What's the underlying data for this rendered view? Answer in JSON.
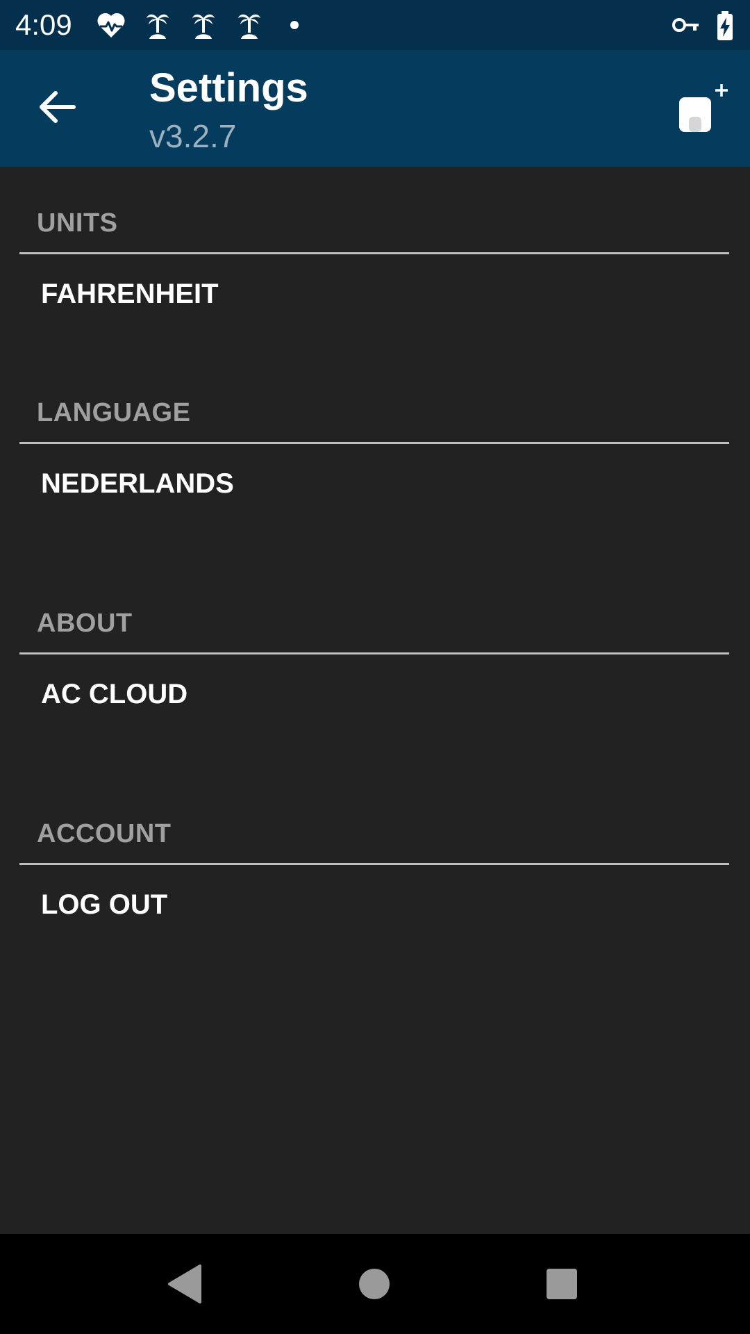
{
  "status_bar": {
    "time": "4:09",
    "icons": [
      "heart-pulse-icon",
      "palm-tree-icon",
      "palm-tree-icon",
      "palm-tree-icon",
      "dot-icon",
      "vpn-key-icon",
      "battery-charging-icon"
    ]
  },
  "app_bar": {
    "title": "Settings",
    "subtitle": "v3.2.7",
    "back_icon": "arrow-left-icon",
    "action_icon": "add-device-icon"
  },
  "sections": [
    {
      "header": "UNITS",
      "item": "FAHRENHEIT"
    },
    {
      "header": "LANGUAGE",
      "item": "NEDERLANDS"
    },
    {
      "header": "ABOUT",
      "item": "AC CLOUD"
    },
    {
      "header": "ACCOUNT",
      "item": "LOG OUT"
    }
  ],
  "nav_bar": {
    "icons": [
      "nav-back-icon",
      "nav-home-icon",
      "nav-recents-icon"
    ]
  },
  "colors": {
    "status_bar": "#04304d",
    "app_bar": "#053c5e",
    "background": "#222222",
    "section_header": "#a0a0a0",
    "divider": "#c0c0c0",
    "item_text": "#ffffff",
    "nav_bar": "#000000"
  }
}
